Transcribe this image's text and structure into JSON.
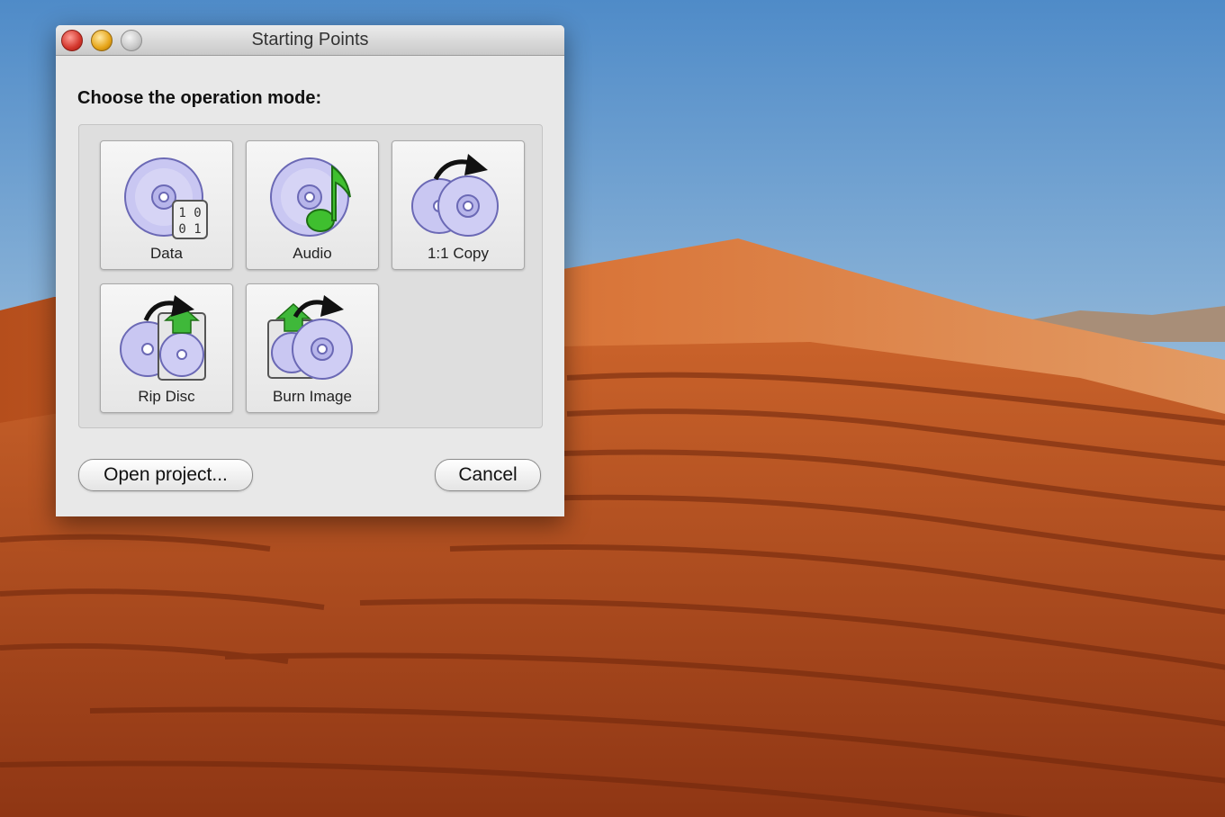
{
  "window": {
    "title": "Starting Points",
    "prompt": "Choose the operation mode:"
  },
  "modes": [
    {
      "label": "Data",
      "icon": "data-disc-icon"
    },
    {
      "label": "Audio",
      "icon": "audio-disc-icon"
    },
    {
      "label": "1:1 Copy",
      "icon": "copy-disc-icon"
    },
    {
      "label": "Rip Disc",
      "icon": "rip-disc-icon"
    },
    {
      "label": "Burn Image",
      "icon": "burn-image-icon"
    }
  ],
  "buttons": {
    "open_project": "Open project...",
    "cancel": "Cancel"
  },
  "data_badge": {
    "row1": "1 0",
    "row2": "0 1"
  },
  "colors": {
    "disc": "#c9c7f2",
    "disc_edge": "#6b69b5",
    "note": "#3fbf2f",
    "arrow_green": "#3fb83a"
  }
}
